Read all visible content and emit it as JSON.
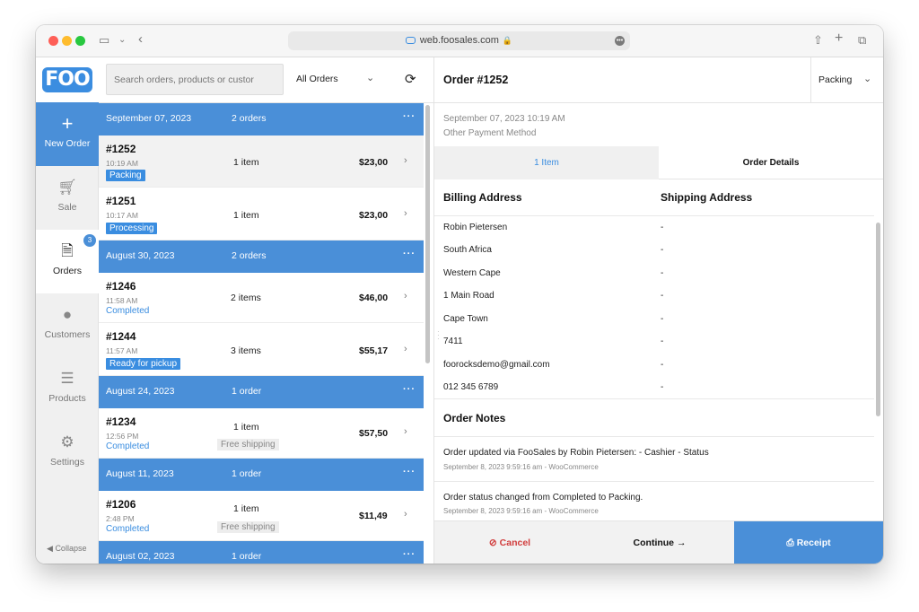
{
  "browser": {
    "url": "web.foosales.com",
    "lock_icon": "lock-icon",
    "site_icon": "link-icon"
  },
  "app": {
    "logo": "FOO",
    "colors": {
      "primary": "#4a8fd8",
      "danger": "#d13c3c",
      "text": "#222222"
    }
  },
  "sidebar": {
    "items": [
      {
        "label": "New Order",
        "icon": "plus-icon"
      },
      {
        "label": "Sale",
        "icon": "cart-icon"
      },
      {
        "label": "Orders",
        "icon": "receipt-icon",
        "badge": "3"
      },
      {
        "label": "Customers",
        "icon": "user-icon"
      },
      {
        "label": "Products",
        "icon": "list-icon"
      },
      {
        "label": "Settings",
        "icon": "gear-icon"
      }
    ],
    "collapse_label": "Collapse"
  },
  "orders_panel": {
    "search_placeholder": "Search orders, products or custor",
    "filter_value": "All Orders",
    "groups": [
      {
        "date": "September 07, 2023",
        "count": "2 orders",
        "orders": [
          {
            "number": "#1252",
            "time": "10:19 AM",
            "status": "Packing",
            "items": "1 item",
            "price": "$23,00"
          },
          {
            "number": "#1251",
            "time": "10:17 AM",
            "status": "Processing",
            "items": "1 item",
            "price": "$23,00"
          }
        ]
      },
      {
        "date": "August 30, 2023",
        "count": "2 orders",
        "orders": [
          {
            "number": "#1246",
            "time": "11:58 AM",
            "status": "Completed",
            "items": "2 items",
            "price": "$46,00"
          },
          {
            "number": "#1244",
            "time": "11:57 AM",
            "status": "Ready for pickup",
            "items": "3 items",
            "price": "$55,17"
          }
        ]
      },
      {
        "date": "August 24, 2023",
        "count": "1 order",
        "orders": [
          {
            "number": "#1234",
            "time": "12:56 PM",
            "status": "Completed",
            "items": "1 item",
            "shipping": "Free shipping",
            "price": "$57,50"
          }
        ]
      },
      {
        "date": "August 11, 2023",
        "count": "1 order",
        "orders": [
          {
            "number": "#1206",
            "time": "2:48 PM",
            "status": "Completed",
            "items": "1 item",
            "shipping": "Free shipping",
            "price": "$11,49"
          }
        ]
      },
      {
        "date": "August 02, 2023",
        "count": "1 order",
        "orders": []
      }
    ]
  },
  "order_detail": {
    "title": "Order #1252",
    "status_select": "Packing",
    "datetime": "September 07, 2023 10:19 AM",
    "payment_method": "Other Payment Method",
    "tabs": {
      "items": "1 Item",
      "details": "Order Details"
    },
    "billing_header": "Billing Address",
    "shipping_header": "Shipping Address",
    "billing": [
      "Robin Pietersen",
      "South Africa",
      "Western Cape",
      "1 Main Road",
      "Cape Town",
      "7411",
      "foorocksdemo@gmail.com",
      "012 345 6789"
    ],
    "shipping": [
      "-",
      "-",
      "-",
      "-",
      "-",
      "-",
      "-",
      "-"
    ],
    "notes_header": "Order Notes",
    "notes": [
      {
        "text": "Order updated via FooSales by Robin Pietersen: - Cashier - Status",
        "meta": "September 8, 2023 9:59:16 am - WooCommerce"
      },
      {
        "text": "Order status changed from Completed to Packing.",
        "meta": "September 8, 2023 9:59:16 am - WooCommerce"
      }
    ],
    "actions": {
      "cancel": "Cancel",
      "continue": "Continue →",
      "receipt": "Receipt"
    }
  }
}
